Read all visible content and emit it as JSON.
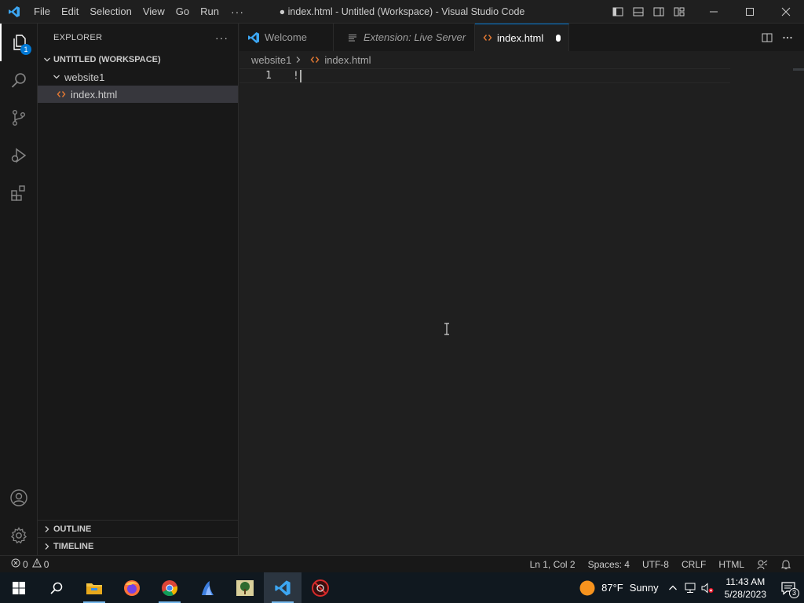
{
  "titlebar": {
    "menu": [
      "File",
      "Edit",
      "Selection",
      "View",
      "Go",
      "Run"
    ],
    "more": "···",
    "title": "● index.html - Untitled (Workspace) - Visual Studio Code"
  },
  "activity": {
    "explorer_badge": "1"
  },
  "sidebar": {
    "header": "EXPLORER",
    "more": "···",
    "workspace": "UNTITLED (WORKSPACE)",
    "folder": "website1",
    "file": "index.html",
    "outline": "OUTLINE",
    "timeline": "TIMELINE"
  },
  "tabs": [
    {
      "label": "Welcome",
      "icon": "vscode-logo-icon"
    },
    {
      "label": "Extension: Live Server",
      "icon": "preview-icon"
    },
    {
      "label": "index.html",
      "icon": "html-icon",
      "dirty": true
    }
  ],
  "breadcrumb": {
    "folder": "website1",
    "file": "index.html"
  },
  "editor": {
    "line_number": "1",
    "line_text": "!"
  },
  "statusbar": {
    "errors": "0",
    "warnings": "0",
    "position": "Ln 1, Col 2",
    "spaces": "Spaces: 4",
    "encoding": "UTF-8",
    "eol": "CRLF",
    "language": "HTML"
  },
  "taskbar": {
    "temperature": "87°F",
    "weather": "Sunny",
    "time": "11:43 AM",
    "date": "5/28/2023",
    "notifications": "3"
  },
  "colors": {
    "accent": "#0078d4",
    "html_icon": "#e37933"
  }
}
